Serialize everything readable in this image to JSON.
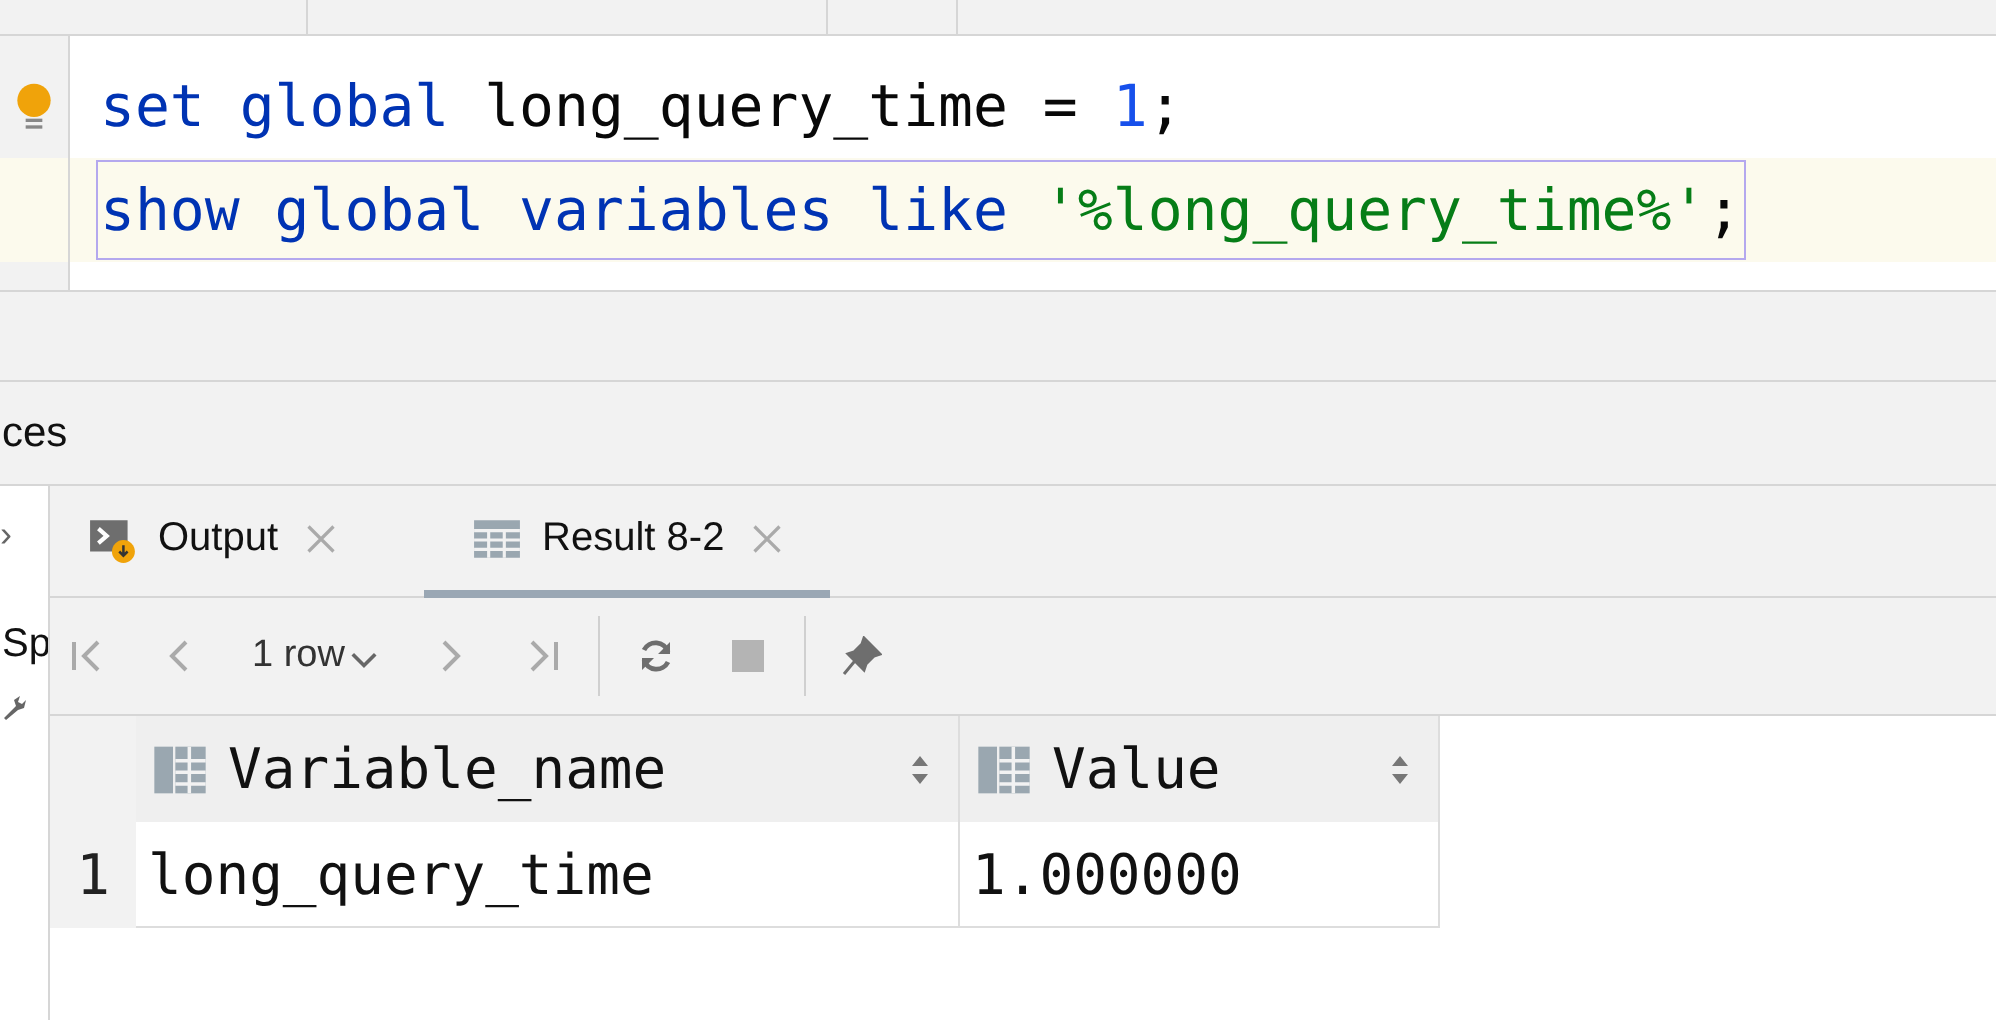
{
  "editor": {
    "lines": [
      {
        "selected": false,
        "tokens": [
          {
            "kind": "keyword",
            "text": "set"
          },
          {
            "kind": "keyword",
            "text": "global"
          },
          {
            "kind": "ident",
            "text": "long_query_time"
          },
          {
            "kind": "ident",
            "text": "="
          },
          {
            "kind": "number",
            "text": "1"
          },
          {
            "kind": "punct",
            "text": ";"
          }
        ]
      },
      {
        "selected": true,
        "tokens": [
          {
            "kind": "keyword",
            "text": "show"
          },
          {
            "kind": "keyword",
            "text": "global"
          },
          {
            "kind": "keyword",
            "text": "variables"
          },
          {
            "kind": "keyword",
            "text": "like"
          },
          {
            "kind": "string",
            "text": "'%long_query_time%'"
          },
          {
            "kind": "punct",
            "text": ";"
          }
        ]
      }
    ]
  },
  "side_panel": {
    "label": "ces",
    "sidebar_items": [
      "›",
      "Sp"
    ]
  },
  "tabs": [
    {
      "label": "Output",
      "kind": "output",
      "selected": false
    },
    {
      "label": "Result 8-2",
      "kind": "table",
      "selected": true
    }
  ],
  "toolbar": {
    "row_count": "1 row"
  },
  "table": {
    "columns": [
      "Variable_name",
      "Value"
    ],
    "rows": [
      {
        "number": "1",
        "cells": [
          "long_query_time",
          "1.000000"
        ]
      }
    ]
  }
}
